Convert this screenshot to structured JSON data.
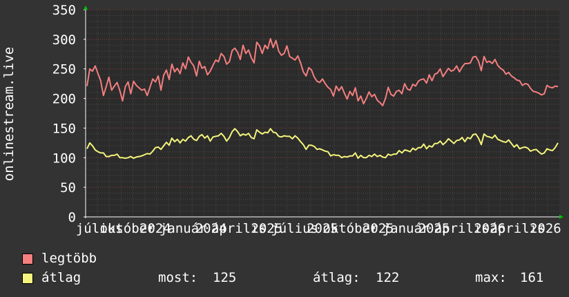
{
  "chart_data": {
    "type": "line",
    "ylabel": "onlinestream.live",
    "ylim": [
      0,
      350
    ],
    "yticks": [
      0,
      50,
      100,
      150,
      200,
      250,
      300,
      350
    ],
    "x_tick_labels": [
      "július",
      "október",
      "2024",
      "január",
      "2024",
      "április",
      "2025",
      "július",
      "2025",
      "október",
      "2025",
      "január",
      "2025",
      "április",
      "2026",
      "április",
      "2026"
    ],
    "grid": true,
    "series": [
      {
        "name": "legtöbb",
        "color": "#f47f7f",
        "values": [
          221,
          250,
          246,
          255,
          242,
          230,
          205,
          220,
          236,
          214,
          221,
          227,
          213,
          196,
          220,
          228,
          208,
          229,
          222,
          218,
          214,
          216,
          205,
          219,
          233,
          228,
          238,
          214,
          239,
          248,
          232,
          258,
          245,
          251,
          242,
          260,
          250,
          270,
          261,
          255,
          238,
          263,
          251,
          254,
          240,
          246,
          256,
          265,
          262,
          276,
          271,
          258,
          262,
          281,
          285,
          278,
          266,
          290,
          276,
          282,
          269,
          260,
          295,
          289,
          276,
          290,
          284,
          301,
          286,
          298,
          280,
          273,
          276,
          289,
          271,
          268,
          265,
          272,
          260,
          245,
          238,
          252,
          248,
          236,
          229,
          227,
          233,
          225,
          219,
          215,
          204,
          221,
          213,
          220,
          209,
          199,
          212,
          205,
          218,
          196,
          204,
          191,
          200,
          211,
          203,
          207,
          197,
          193,
          188,
          200,
          219,
          207,
          204,
          212,
          214,
          208,
          225,
          216,
          214,
          224,
          221,
          229,
          232,
          233,
          226,
          240,
          230,
          241,
          243,
          250,
          237,
          244,
          251,
          246,
          248,
          255,
          245,
          253,
          259,
          259,
          260,
          270,
          271,
          263,
          247,
          271,
          261,
          263,
          259,
          266,
          256,
          251,
          248,
          241,
          244,
          238,
          235,
          231,
          230,
          222,
          225,
          224,
          217,
          212,
          211,
          209,
          206,
          208,
          222,
          219,
          218,
          221,
          220
        ]
      },
      {
        "name": "átlag",
        "color": "#f5f57d",
        "values": [
          115,
          125,
          120,
          113,
          110,
          108,
          108,
          102,
          102,
          104,
          104,
          106,
          100,
          100,
          99,
          100,
          102,
          99,
          101,
          102,
          103,
          105,
          107,
          106,
          111,
          117,
          118,
          114,
          120,
          126,
          121,
          133,
          127,
          131,
          125,
          131,
          128,
          134,
          137,
          131,
          129,
          136,
          139,
          133,
          137,
          128,
          135,
          136,
          137,
          141,
          136,
          128,
          134,
          144,
          149,
          144,
          137,
          140,
          138,
          141,
          134,
          132,
          147,
          143,
          140,
          143,
          142,
          149,
          143,
          142,
          136,
          135,
          137,
          136,
          136,
          132,
          137,
          133,
          127,
          122,
          114,
          121,
          121,
          119,
          114,
          115,
          113,
          111,
          110,
          103,
          105,
          104,
          104,
          100,
          102,
          101,
          103,
          103,
          108,
          99,
          104,
          100,
          100,
          104,
          102,
          106,
          102,
          104,
          101,
          100,
          106,
          104,
          106,
          106,
          112,
          108,
          113,
          112,
          110,
          116,
          113,
          117,
          117,
          123,
          115,
          120,
          118,
          124,
          124,
          128,
          122,
          126,
          132,
          128,
          124,
          129,
          130,
          134,
          127,
          134,
          132,
          139,
          140,
          133,
          122,
          140,
          136,
          135,
          133,
          138,
          131,
          129,
          127,
          126,
          130,
          124,
          118,
          122,
          115,
          117,
          118,
          116,
          111,
          113,
          114,
          110,
          106,
          108,
          115,
          113,
          112,
          117,
          125
        ]
      }
    ]
  },
  "legend": {
    "items": [
      {
        "label": "legtöbb",
        "color": "#f47f7f"
      },
      {
        "label": "átlag",
        "color": "#f5f57d"
      }
    ],
    "stats": {
      "now_label": "most:",
      "now_value": "125",
      "avg_label": "átlag:",
      "avg_value": "122",
      "max_label": "max:",
      "max_value": "161"
    }
  }
}
